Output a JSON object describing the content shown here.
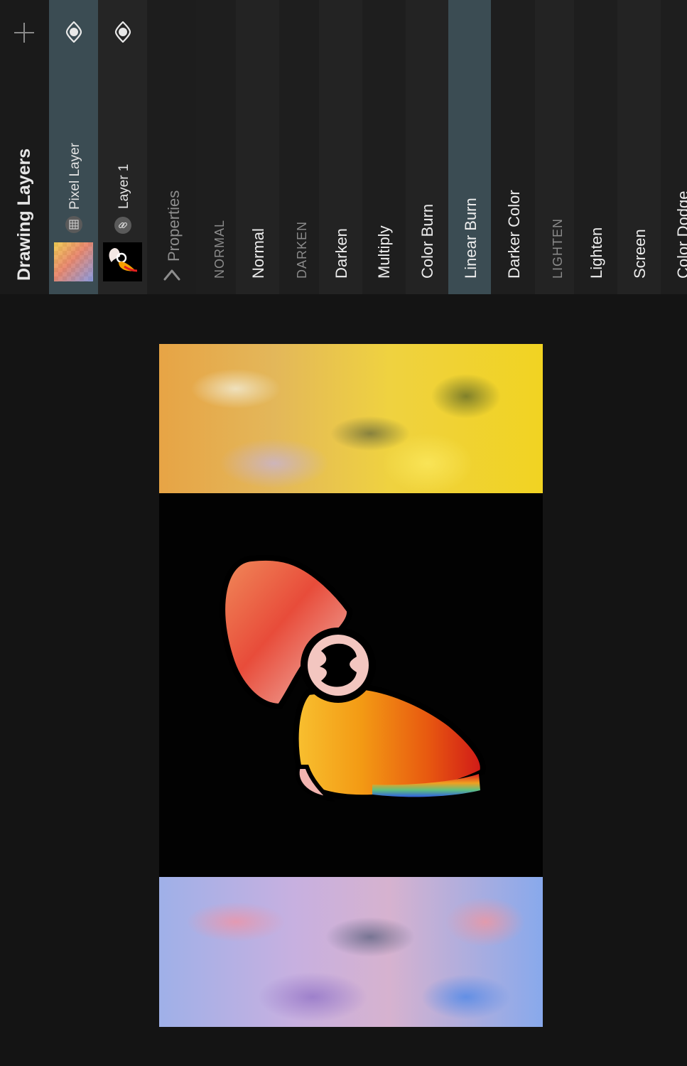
{
  "panel": {
    "title": "Drawing Layers",
    "add_icon": "plus-icon",
    "properties_label": "Properties"
  },
  "layers": [
    {
      "name": "Pixel Layer",
      "selected": true,
      "type_icon": "grid-icon",
      "visibility_icon": "eye-icon"
    },
    {
      "name": "Layer 1",
      "selected": false,
      "type_icon": "link-icon",
      "visibility_icon": "eye-icon"
    }
  ],
  "blend_modes": [
    {
      "label": "NORMAL",
      "section": true
    },
    {
      "label": "Normal",
      "section": false
    },
    {
      "label": "DARKEN",
      "section": true
    },
    {
      "label": "Darken",
      "section": false
    },
    {
      "label": "Multiply",
      "section": false
    },
    {
      "label": "Color Burn",
      "section": false
    },
    {
      "label": "Linear Burn",
      "section": false,
      "selected": true
    },
    {
      "label": "Darker Color",
      "section": false
    },
    {
      "label": "LIGHTEN",
      "section": true
    },
    {
      "label": "Lighten",
      "section": false
    },
    {
      "label": "Screen",
      "section": false
    },
    {
      "label": "Color Dodge",
      "section": false
    }
  ],
  "colors": {
    "selected_row": "#3b4c53",
    "panel_bg": "#1d1d1d",
    "app_bg": "#141414"
  }
}
